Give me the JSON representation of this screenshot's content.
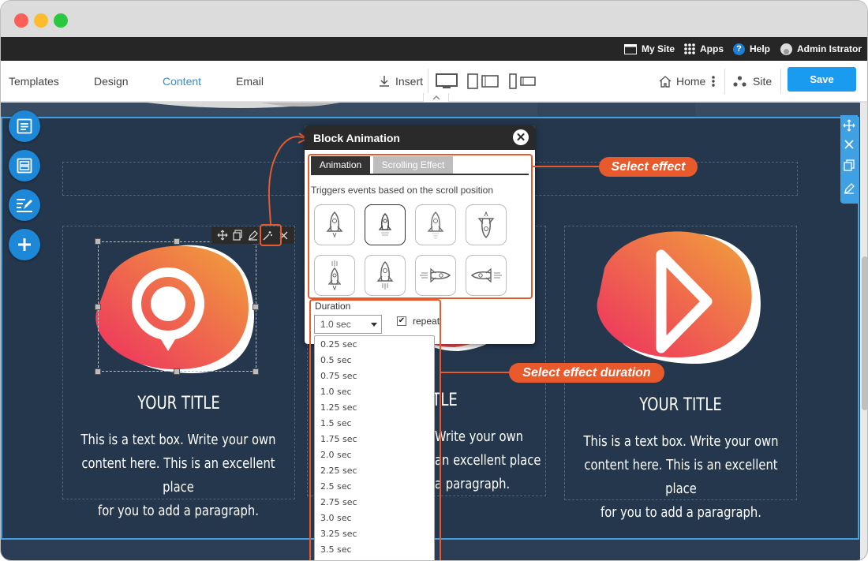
{
  "topbar": {
    "my_site": "My Site",
    "apps": "Apps",
    "help": "Help",
    "user": "Admin Istrator"
  },
  "nav": {
    "templates": "Templates",
    "design": "Design",
    "content": "Content",
    "email": "Email",
    "insert": "Insert",
    "home": "Home",
    "site": "Site",
    "save": "Save"
  },
  "columns": [
    {
      "title": "YOUR TITLE",
      "text": [
        "This is a text box. Write your own",
        "content here. This is an excellent place",
        "for you to add a paragraph."
      ]
    },
    {
      "title": "TITLE",
      "text": [
        "Write your own",
        "an excellent place",
        "a paragraph."
      ]
    },
    {
      "title": "YOUR TITLE",
      "text": [
        "This is a text box. Write your own",
        "content here. This is an excellent place",
        "for you to add a paragraph."
      ]
    }
  ],
  "dialog": {
    "title": "Block Animation",
    "close": "✕",
    "tabs": [
      "Animation",
      "Scrolling Effect"
    ],
    "description": "Triggers events based on the scroll position",
    "effects": [
      "rocket-up-1",
      "rocket-up-2",
      "rocket-up-3",
      "rocket-down",
      "rocket-launch-1",
      "rocket-launch-2",
      "rocket-right",
      "rocket-left"
    ],
    "duration_label": "Duration",
    "duration_value": "1.0 sec",
    "repeat_label": "repeat",
    "repeat_checked": "✔",
    "duration_options": [
      "0.25 sec",
      "0.5 sec",
      "0.75 sec",
      "1.0 sec",
      "1.25 sec",
      "1.5 sec",
      "1.75 sec",
      "2.0 sec",
      "2.25 sec",
      "2.5 sec",
      "2.75 sec",
      "3.0 sec",
      "3.25 sec",
      "3.5 sec"
    ]
  },
  "callouts": {
    "select_effect": "Select effect",
    "select_duration": "Select effect duration"
  },
  "colors": {
    "accent": "#1a9bf0",
    "callout": "#e85a2c",
    "canvas": "#24374d"
  }
}
